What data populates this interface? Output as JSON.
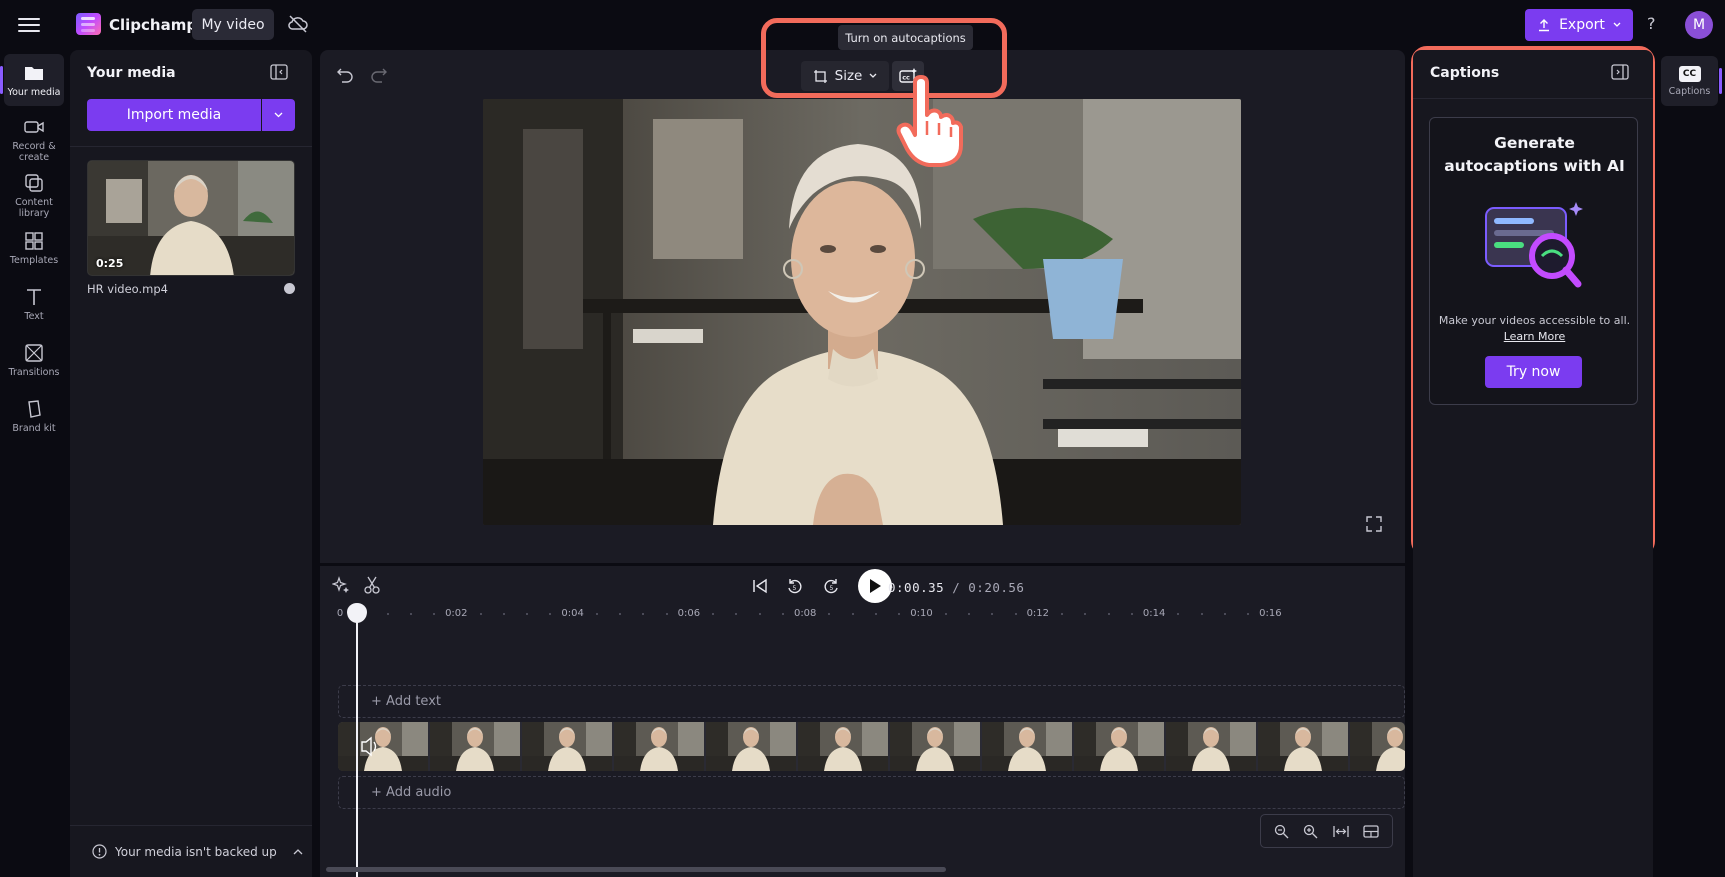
{
  "topbar": {
    "app_name": "Clipchamp",
    "project_name": "My video",
    "export_label": "Export",
    "help": "?",
    "avatar_initial": "M"
  },
  "leftnav": {
    "items": [
      {
        "label": "Your media",
        "icon": "folder-icon",
        "active": true
      },
      {
        "label": "Record &\ncreate",
        "icon": "camera-icon"
      },
      {
        "label": "Content\nlibrary",
        "icon": "library-icon"
      },
      {
        "label": "Templates",
        "icon": "templates-icon"
      },
      {
        "label": "Text",
        "icon": "text-icon"
      },
      {
        "label": "Transitions",
        "icon": "transitions-icon"
      },
      {
        "label": "Brand kit",
        "icon": "brand-kit-icon"
      }
    ]
  },
  "media_panel": {
    "title": "Your media",
    "import_label": "Import media",
    "items": [
      {
        "duration": "0:25",
        "filename": "HR video.mp4"
      }
    ],
    "backup_text": "Your media isn't backed up"
  },
  "preview": {
    "size_label": "Size",
    "tooltip": "Turn on autocaptions"
  },
  "captions_panel": {
    "title": "Captions",
    "card_heading": "Generate autocaptions with AI",
    "card_text": "Make your videos accessible to all.",
    "learn_more": "Learn More",
    "try_label": "Try now"
  },
  "right_rail": {
    "captions_label": "Captions",
    "captions_badge": "CC"
  },
  "timeline": {
    "current_time": "0:00.35",
    "separator": "/",
    "duration": "0:20.56",
    "ruler_labels": [
      "0",
      "0:02",
      "0:04",
      "0:06",
      "0:08",
      "0:10",
      "0:12",
      "0:14",
      "0:16"
    ],
    "add_text": "+ Add text",
    "add_audio": "+ Add audio"
  },
  "colors": {
    "accent": "#7b3cf0",
    "highlight": "#f26b5b",
    "background": "#0b0b12",
    "panel": "#17171f"
  }
}
